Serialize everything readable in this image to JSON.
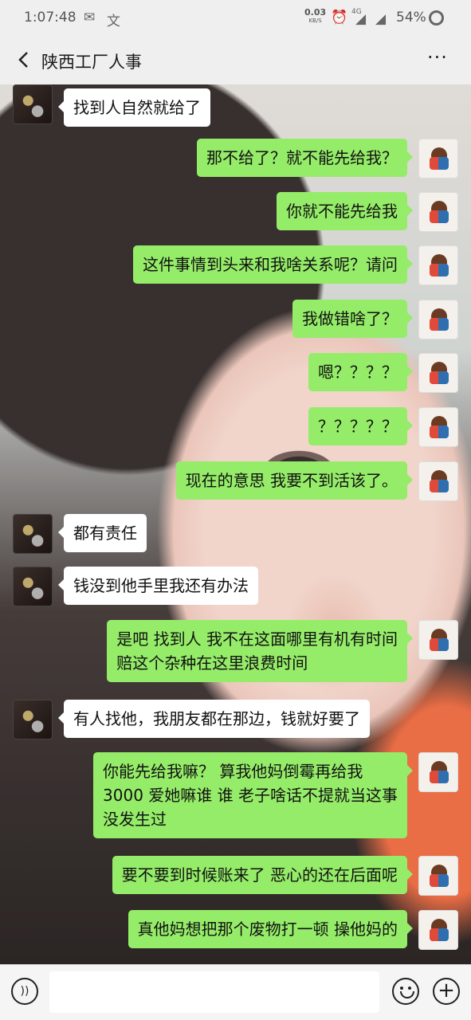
{
  "status_bar": {
    "time": "1:07:48",
    "net_speed": "0.03",
    "net_unit": "KB/S",
    "network": "4G",
    "battery": "54%"
  },
  "header": {
    "title": "陕西工厂人事",
    "more": "···"
  },
  "messages": [
    {
      "side": "in",
      "text": "找到人自然就给了"
    },
    {
      "side": "out",
      "text": "那不给了？就不能先给我？"
    },
    {
      "side": "out",
      "text": "你就不能先给我"
    },
    {
      "side": "out",
      "text": "这件事情到头来和我啥关系呢？请问"
    },
    {
      "side": "out",
      "text": "我做错啥了？"
    },
    {
      "side": "out",
      "text": "嗯？？？？"
    },
    {
      "side": "out",
      "text": "？？？？？"
    },
    {
      "side": "out",
      "text": "现在的意思 我要不到活该了。"
    },
    {
      "side": "in",
      "text": "都有责任"
    },
    {
      "side": "in",
      "text": "钱没到他手里我还有办法"
    },
    {
      "side": "out",
      "lines": [
        "是吧 找到人 我不在这面哪里有机有时间",
        "赔这个杂种在这里浪费时间"
      ]
    },
    {
      "side": "in",
      "text": "有人找他，我朋友都在那边，钱就好要了"
    },
    {
      "side": "out",
      "lines": [
        "你能先给我嘛？ 算我他妈倒霉再给我",
        "3000 爱她嘛谁 谁 老子啥话不提就当这事",
        "没发生过"
      ]
    },
    {
      "side": "out",
      "text": "要不要到时候账来了 恶心的还在后面呢"
    },
    {
      "side": "out",
      "text": "真他妈想把那个废物打一顿 操他妈的"
    }
  ],
  "colors": {
    "outgoing_bubble": "#95ec69",
    "incoming_bubble": "#ffffff"
  },
  "icons": {
    "voice": "voice-icon",
    "emoji": "emoji-icon",
    "plus": "plus-icon"
  }
}
